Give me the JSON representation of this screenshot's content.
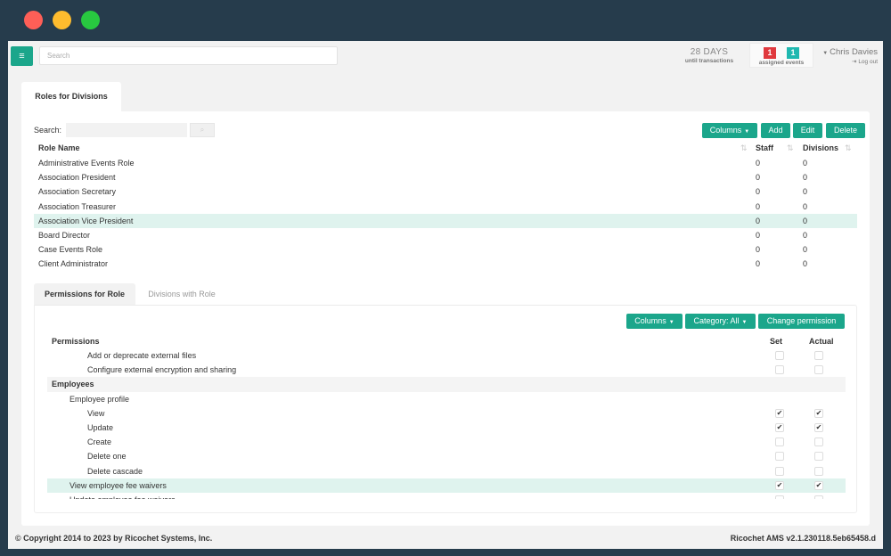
{
  "header": {
    "search_placeholder": "Search",
    "days": {
      "value": "28 DAYS",
      "label": "until transactions"
    },
    "events": {
      "red_count": "1",
      "teal_count": "1",
      "label": "assigned events"
    },
    "user": {
      "name": "Chris Davies",
      "logout": "Log out"
    }
  },
  "main_tab": "Roles for Divisions",
  "roles": {
    "search_label": "Search:",
    "buttons": {
      "columns": "Columns",
      "add": "Add",
      "edit": "Edit",
      "delete": "Delete"
    },
    "columns": {
      "name": "Role Name",
      "staff": "Staff",
      "divisions": "Divisions"
    },
    "rows": [
      {
        "name": "Administrative Events Role",
        "staff": "0",
        "divisions": "0"
      },
      {
        "name": "Association President",
        "staff": "0",
        "divisions": "0"
      },
      {
        "name": "Association Secretary",
        "staff": "0",
        "divisions": "0"
      },
      {
        "name": "Association Treasurer",
        "staff": "0",
        "divisions": "0"
      },
      {
        "name": "Association Vice President",
        "staff": "0",
        "divisions": "0"
      },
      {
        "name": "Board Director",
        "staff": "0",
        "divisions": "0"
      },
      {
        "name": "Case Events Role",
        "staff": "0",
        "divisions": "0"
      },
      {
        "name": "Client Administrator",
        "staff": "0",
        "divisions": "0"
      }
    ]
  },
  "sub_tabs": {
    "permissions": "Permissions for Role",
    "divisions": "Divisions with Role"
  },
  "permissions": {
    "buttons": {
      "columns": "Columns",
      "category": "Category: All",
      "change": "Change permission"
    },
    "columns": {
      "name": "Permissions",
      "set": "Set",
      "actual": "Actual"
    },
    "rows": [
      {
        "label": "Add or deprecate external files",
        "level": 2,
        "set": false,
        "actual": false
      },
      {
        "label": "Configure external encryption and sharing",
        "level": 2,
        "set": false,
        "actual": false
      },
      {
        "label": "Employees",
        "level": 0,
        "group": true
      },
      {
        "label": "Employee profile",
        "level": 1
      },
      {
        "label": "View",
        "level": 2,
        "set": true,
        "actual": true
      },
      {
        "label": "Update",
        "level": 2,
        "set": true,
        "actual": true
      },
      {
        "label": "Create",
        "level": 2,
        "set": false,
        "actual": false
      },
      {
        "label": "Delete one",
        "level": 2,
        "set": false,
        "actual": false
      },
      {
        "label": "Delete cascade",
        "level": 2,
        "set": false,
        "actual": false
      },
      {
        "label": "View employee fee waivers",
        "level": 1,
        "set": true,
        "actual": true
      },
      {
        "label": "Update employee fee waivers",
        "level": 1,
        "set": false,
        "actual": false
      }
    ]
  },
  "footer": {
    "copyright": "© Copyright 2014 to 2023 by Ricochet Systems, Inc.",
    "version": "Ricochet AMS v2.1.230118.5eb65458.d"
  }
}
